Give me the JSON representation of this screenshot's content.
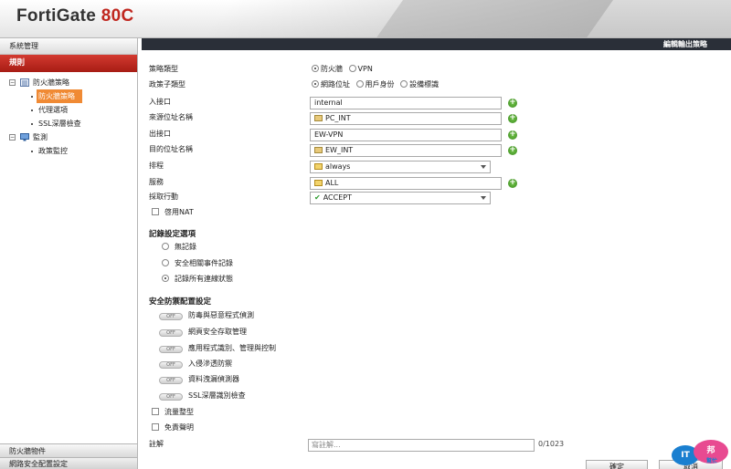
{
  "header": {
    "brand": "FortiGate",
    "model": "80C"
  },
  "sidebar": {
    "system_management": "系統管理",
    "active_section": "規則",
    "tree": {
      "firewall_policy": "防火牆策略",
      "firewall_policy_item": "防火牆策略",
      "proxy_options": "代理選項",
      "ssl_inspection": "SSL深層檢查",
      "monitor": "監測",
      "policy_monitor": "政策監控"
    },
    "bottom1": "防火牆物件",
    "bottom2": "網路安全配置設定"
  },
  "main": {
    "title": "編輯輸出策略",
    "policy_type": {
      "label": "策略類型",
      "options": [
        "防火牆",
        "VPN"
      ],
      "selected": "防火牆"
    },
    "policy_subtype": {
      "label": "政策子類型",
      "options": [
        "網路位址",
        "用戶身份",
        "設備標識"
      ],
      "selected": "網路位址"
    },
    "incoming_interface": {
      "label": "入接口",
      "value": "internal"
    },
    "source_address": {
      "label": "來源位址名稱",
      "value": "PC_INT"
    },
    "outgoing_interface": {
      "label": "出接口",
      "value": "EW-VPN"
    },
    "destination_address": {
      "label": "目的位址名稱",
      "value": "EW_INT"
    },
    "schedule": {
      "label": "排程",
      "value": "always"
    },
    "service": {
      "label": "服務",
      "value": "ALL"
    },
    "action": {
      "label": "採取行動",
      "value": "ACCEPT"
    },
    "nat": {
      "label": "啓用NAT"
    },
    "logging": {
      "heading": "記錄設定選項",
      "options": [
        "無記錄",
        "安全相關事件記錄",
        "記錄所有連線狀態"
      ],
      "selected": "記錄所有連線狀態"
    },
    "security": {
      "heading": "安全防禦配置設定",
      "off_label": "OFF",
      "items": [
        "防毒與惡意程式偵測",
        "網頁安全存取管理",
        "應用程式識別、管理與控制",
        "入侵滲透防禦",
        "資料洩漏偵測器",
        "SSL深層識別檢查"
      ]
    },
    "traffic_shaping": {
      "label": "流量整型"
    },
    "disclaimer": {
      "label": "免責聲明"
    },
    "comment": {
      "label": "註解",
      "placeholder": "寫註解...",
      "counter": "0/1023"
    },
    "buttons": {
      "ok": "確定",
      "cancel": "取消"
    }
  },
  "watermark": {
    "a": "IT",
    "b": "邦",
    "c": "幫忙"
  }
}
